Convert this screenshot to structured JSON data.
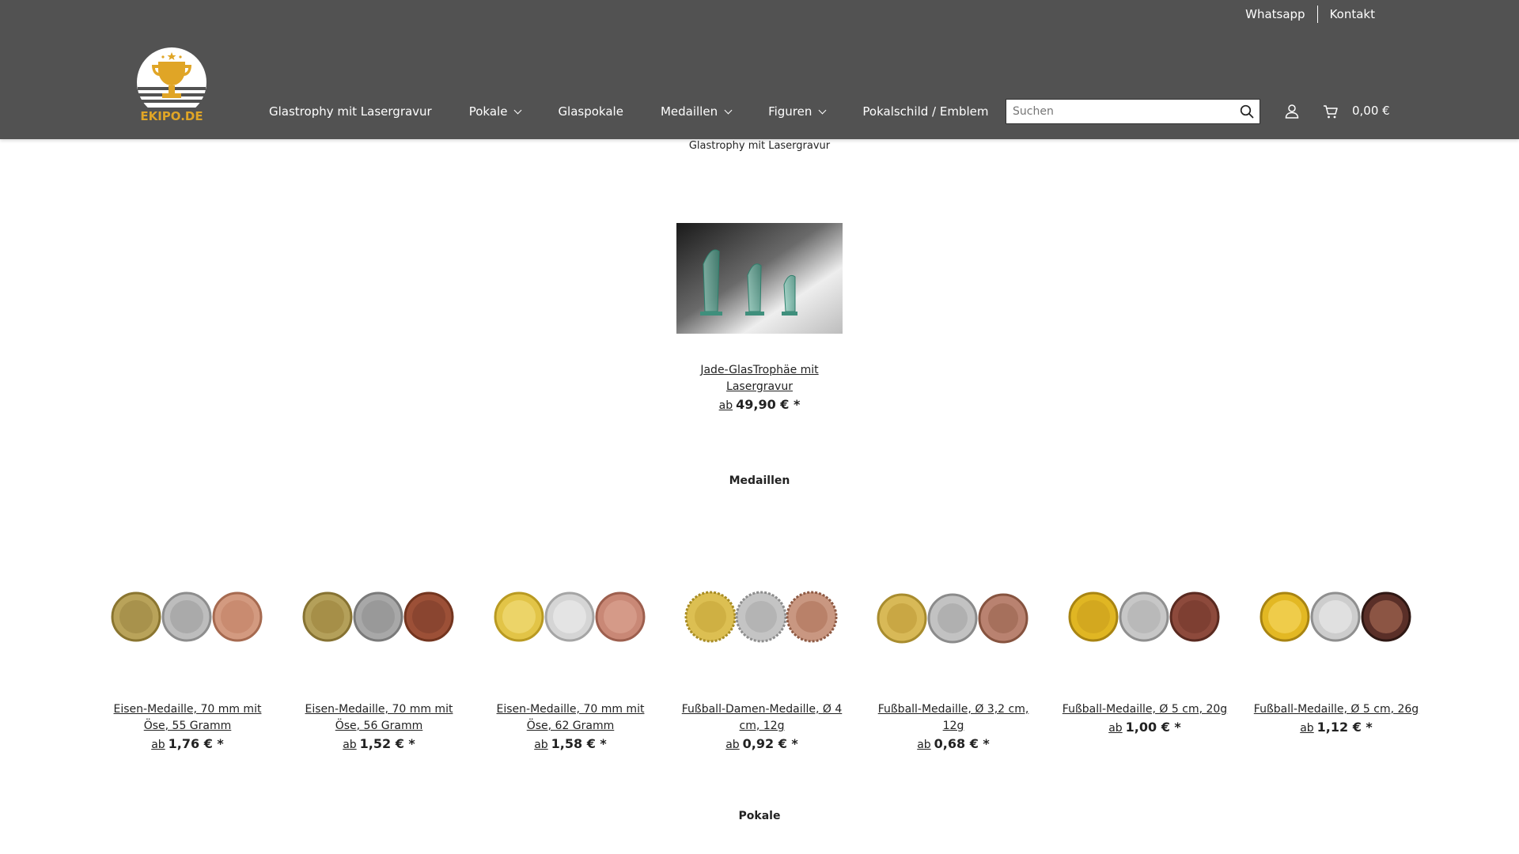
{
  "topbar": {
    "whatsapp": "Whatsapp",
    "kontakt": "Kontakt"
  },
  "logo": {
    "text": "EKIPO.DE"
  },
  "nav": [
    {
      "label": "Glastrophy mit Lasergravur",
      "dropdown": false
    },
    {
      "label": "Pokale",
      "dropdown": true
    },
    {
      "label": "Glaspokale",
      "dropdown": false
    },
    {
      "label": "Medaillen",
      "dropdown": true
    },
    {
      "label": "Figuren",
      "dropdown": true
    },
    {
      "label": "Pokalschild / Emblem",
      "dropdown": false
    }
  ],
  "search": {
    "placeholder": "Suchen"
  },
  "cart": {
    "total": "0,00 €"
  },
  "breadcrumb": "Glastrophy mit Lasergravur",
  "feature": {
    "name": "Jade-GlasTrophäe mit Lasergravur",
    "ab": "ab",
    "price": "49,90 € *"
  },
  "sections": {
    "medaillen": "Medaillen",
    "pokale": "Pokale"
  },
  "colors": {
    "header": "#525252",
    "gold": "#c9a94b",
    "silver": "#b6b6b6",
    "bronze": "#b4735a"
  },
  "products": [
    {
      "name": "Eisen-Medaille, 70 mm mit Öse, 55 Gramm",
      "ab": "ab",
      "price": "1,76 € *"
    },
    {
      "name": "Eisen-Medaille, 70 mm mit Öse, 56 Gramm",
      "ab": "ab",
      "price": "1,52 € *"
    },
    {
      "name": "Eisen-Medaille, 70 mm mit Öse, 62 Gramm",
      "ab": "ab",
      "price": "1,58 € *"
    },
    {
      "name": "Fußball-Damen-Medaille, Ø 4 cm, 12g",
      "ab": "ab",
      "price": "0,92 € *"
    },
    {
      "name": "Fußball-Medaille, Ø 3,2 cm, 12g",
      "ab": "ab",
      "price": "0,68 € *"
    },
    {
      "name": "Fußball-Medaille, Ø 5 cm, 20g",
      "ab": "ab",
      "price": "1,00 € *"
    },
    {
      "name": "Fußball-Medaille, Ø 5 cm, 26g",
      "ab": "ab",
      "price": "1,12 € *"
    }
  ]
}
